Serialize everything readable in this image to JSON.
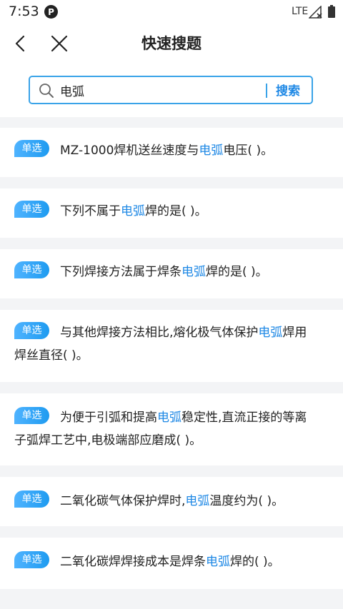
{
  "status_bar": {
    "time": "7:53",
    "app_icon_letter": "P",
    "network": "LTE"
  },
  "header": {
    "title": "快速搜题",
    "back_icon": "chevron-left-icon",
    "close_icon": "close-icon"
  },
  "search": {
    "value": "电弧",
    "button_label": "搜索"
  },
  "colors": {
    "accent": "#1e88e5",
    "badge": "#1e9bf0",
    "border": "#3aa3e8"
  },
  "results": [
    {
      "tag": "单选",
      "before": "MZ-1000焊机送丝速度与",
      "keyword": "电弧",
      "after": "电压( )。"
    },
    {
      "tag": "单选",
      "before": "下列不属于",
      "keyword": "电弧",
      "after": "焊的是( )。"
    },
    {
      "tag": "单选",
      "before": "下列焊接方法属于焊条",
      "keyword": "电弧",
      "after": "焊的是( )。"
    },
    {
      "tag": "单选",
      "before": "与其他焊接方法相比,熔化极气体保护",
      "keyword": "电弧",
      "after": "焊用焊丝直径( )。"
    },
    {
      "tag": "单选",
      "before": "为便于引弧和提高",
      "keyword": "电弧",
      "after": "稳定性,直流正接的等离子弧焊工艺中,电极端部应磨成( )。"
    },
    {
      "tag": "单选",
      "before": "二氧化碳气体保护焊时,",
      "keyword": "电弧",
      "after": "温度约为( )。"
    },
    {
      "tag": "单选",
      "before": "二氧化碳焊焊接成本是焊条",
      "keyword": "电弧",
      "after": "焊的( )。"
    }
  ]
}
